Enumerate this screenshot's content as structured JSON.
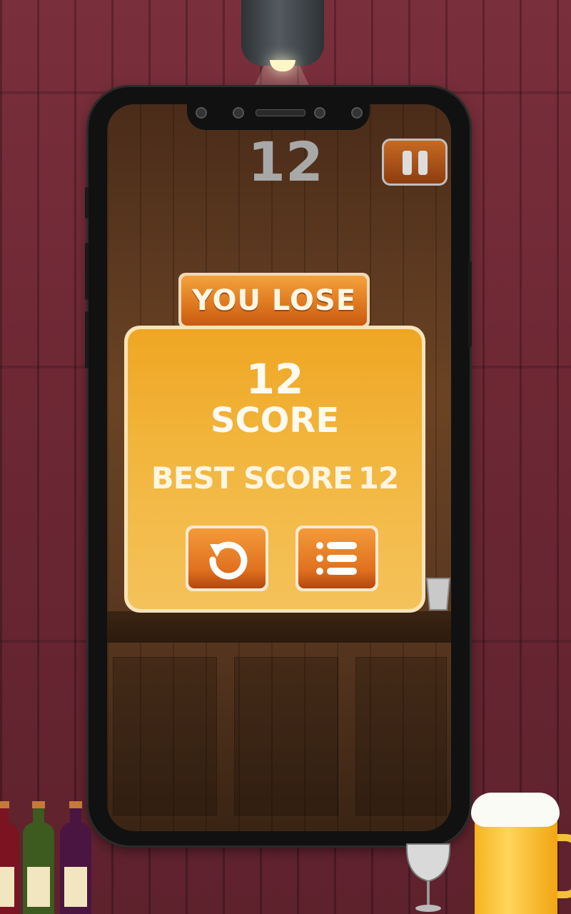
{
  "game": {
    "current_score": "12",
    "result_title": "YOU LOSE",
    "final_score": "12",
    "score_label": "SCORE",
    "best_score_label": "BEST SCORE",
    "best_score_value": "12"
  },
  "buttons": {
    "pause_icon": "pause-icon",
    "restart_icon": "restart-icon",
    "menu_icon": "menu-icon"
  },
  "colors": {
    "accent_orange": "#e07a20",
    "panel_yellow": "#f2b63e",
    "wall": "#6b2733"
  }
}
